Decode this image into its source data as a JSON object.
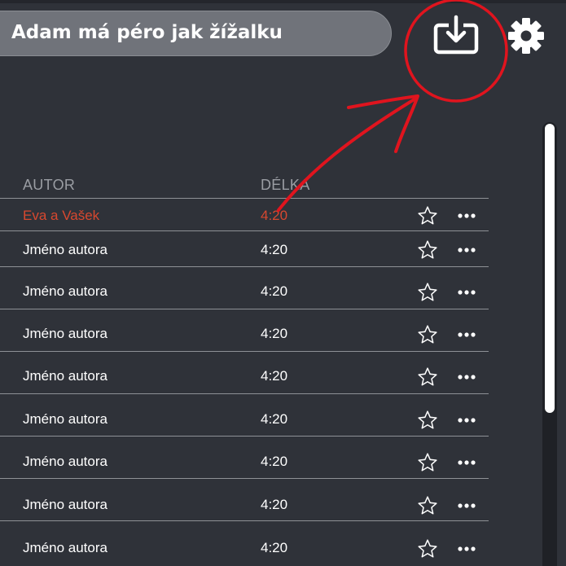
{
  "search": {
    "query": "Adam má péro jak žížalku"
  },
  "toolbar": {
    "download_icon": "download-icon",
    "settings_icon": "gear-icon"
  },
  "table": {
    "columns": {
      "author": "AUTOR",
      "length": "DÉLKA"
    },
    "rows": [
      {
        "author": "Eva a Vašek",
        "length": "4:20",
        "active": true
      },
      {
        "author": "Jméno autora",
        "length": "4:20",
        "active": false
      },
      {
        "author": "Jméno autora",
        "length": "4:20",
        "active": false
      },
      {
        "author": "Jméno autora",
        "length": "4:20",
        "active": false
      },
      {
        "author": "Jméno autora",
        "length": "4:20",
        "active": false
      },
      {
        "author": "Jméno autora",
        "length": "4:20",
        "active": false
      },
      {
        "author": "Jméno autora",
        "length": "4:20",
        "active": false
      },
      {
        "author": "Jméno autora",
        "length": "4:20",
        "active": false
      },
      {
        "author": "Jméno autora",
        "length": "4:20",
        "active": false
      }
    ],
    "row_icons": {
      "favorite": "star-icon",
      "more": "more-icon"
    }
  },
  "colors": {
    "background": "#2f3239",
    "active_row": "#d8482f",
    "annotation": "#e0141e",
    "search_bg": "#70737a"
  }
}
